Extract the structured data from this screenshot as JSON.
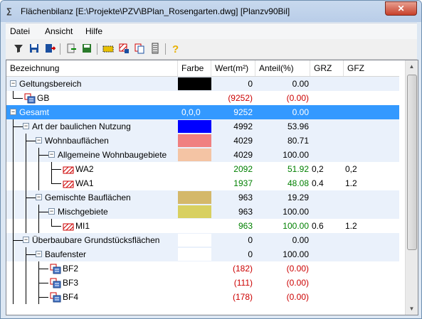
{
  "window": {
    "title": "Flächenbilanz [E:\\Projekte\\PZV\\BPlan_Rosengarten.dwg] [Planzv90Bil]",
    "close_label": "✕"
  },
  "menu": {
    "items": [
      "Datei",
      "Ansicht",
      "Hilfe"
    ]
  },
  "toolbar": {
    "icons": [
      "filter-icon",
      "save-icon",
      "export-icon",
      "import-icon",
      "save-layer-icon",
      "area-icon",
      "hatch-icon",
      "copy-icon",
      "list-icon",
      "help-icon"
    ]
  },
  "table": {
    "columns": [
      "Bezeichnung",
      "Farbe",
      "Wert(m²)",
      "Anteil(%)",
      "GRZ",
      "GFZ"
    ],
    "rows": [
      {
        "label": "Geltungsbereich",
        "color": "#000000",
        "farbe_text": "",
        "wert": "0",
        "anteil": "0.00",
        "grz": "",
        "gfz": "",
        "style": "normal"
      },
      {
        "label": "GB",
        "color": "",
        "farbe_text": "",
        "wert": "(9252)",
        "anteil": "(0.00)",
        "grz": "",
        "gfz": "",
        "style": "red"
      },
      {
        "label": "Gesamt",
        "color": "",
        "farbe_text": "0,0,0",
        "wert": "9252",
        "anteil": "0.00",
        "grz": "",
        "gfz": "",
        "style": "normal"
      },
      {
        "label": "Art der baulichen Nutzung",
        "color": "#0000ff",
        "farbe_text": "",
        "wert": "4992",
        "anteil": "53.96",
        "grz": "",
        "gfz": "",
        "style": "normal"
      },
      {
        "label": "Wohnbauflächen",
        "color": "#f08080",
        "farbe_text": "",
        "wert": "4029",
        "anteil": "80.71",
        "grz": "",
        "gfz": "",
        "style": "normal"
      },
      {
        "label": "Allgemeine Wohnbaugebiete",
        "color": "#f4c4a4",
        "farbe_text": "",
        "wert": "4029",
        "anteil": "100.00",
        "grz": "",
        "gfz": "",
        "style": "normal"
      },
      {
        "label": "WA2",
        "color": "",
        "farbe_text": "",
        "wert": "2092",
        "anteil": "51.92",
        "grz": "0,2",
        "gfz": "0,2",
        "style": "green"
      },
      {
        "label": "WA1",
        "color": "",
        "farbe_text": "",
        "wert": "1937",
        "anteil": "48.08",
        "grz": "0.4",
        "gfz": "1.2",
        "style": "green"
      },
      {
        "label": "Gemischte Bauflächen",
        "color": "#d4b86a",
        "farbe_text": "",
        "wert": "963",
        "anteil": "19.29",
        "grz": "",
        "gfz": "",
        "style": "normal"
      },
      {
        "label": "Mischgebiete",
        "color": "#d8d060",
        "farbe_text": "",
        "wert": "963",
        "anteil": "100.00",
        "grz": "",
        "gfz": "",
        "style": "normal"
      },
      {
        "label": "MI1",
        "color": "",
        "farbe_text": "",
        "wert": "963",
        "anteil": "100.00",
        "grz": "0.6",
        "gfz": "1.2",
        "style": "green"
      },
      {
        "label": "Überbaubare Grundstücksflächen",
        "color": "#ffffff",
        "farbe_text": "",
        "wert": "0",
        "anteil": "0.00",
        "grz": "",
        "gfz": "",
        "style": "normal"
      },
      {
        "label": "Baufenster",
        "color": "#ffffff",
        "farbe_text": "",
        "wert": "0",
        "anteil": "100.00",
        "grz": "",
        "gfz": "",
        "style": "normal"
      },
      {
        "label": "BF2",
        "color": "",
        "farbe_text": "",
        "wert": "(182)",
        "anteil": "(0.00)",
        "grz": "",
        "gfz": "",
        "style": "red"
      },
      {
        "label": "BF3",
        "color": "",
        "farbe_text": "",
        "wert": "(111)",
        "anteil": "(0.00)",
        "grz": "",
        "gfz": "",
        "style": "red"
      },
      {
        "label": "BF4",
        "color": "",
        "farbe_text": "",
        "wert": "(178)",
        "anteil": "(0.00)",
        "grz": "",
        "gfz": "",
        "style": "red"
      }
    ]
  },
  "colors": {
    "selection": "#3399ff",
    "alt_row": "#eaf1fb",
    "red_text": "#cc0000",
    "green_text": "#008000"
  }
}
